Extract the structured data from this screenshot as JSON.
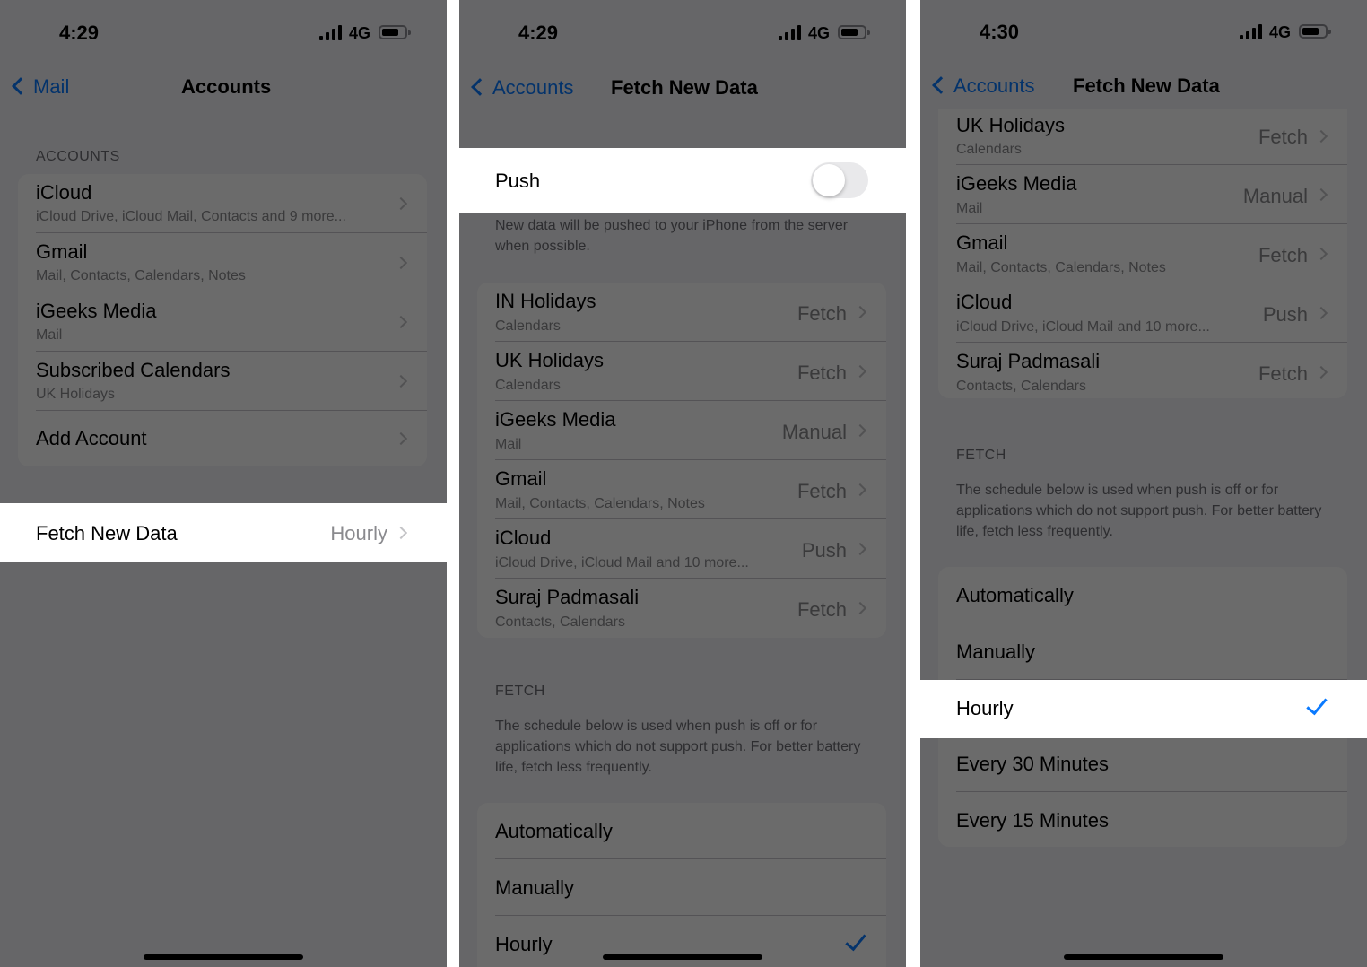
{
  "colors": {
    "accent": "#0a7aff",
    "background": "#f2f2f7",
    "secondary_text": "#8a8a8e"
  },
  "screen1": {
    "status": {
      "time": "4:29",
      "network": "4G"
    },
    "nav": {
      "back_label": "Mail",
      "title": "Accounts"
    },
    "section_label": "ACCOUNTS",
    "accounts": [
      {
        "title": "iCloud",
        "subtitle": "iCloud Drive, iCloud Mail, Contacts and 9 more..."
      },
      {
        "title": "Gmail",
        "subtitle": "Mail, Contacts, Calendars, Notes"
      },
      {
        "title": "iGeeks Media",
        "subtitle": "Mail"
      },
      {
        "title": "Subscribed Calendars",
        "subtitle": "UK Holidays"
      },
      {
        "title": "Add Account",
        "subtitle": ""
      }
    ],
    "fetch_row": {
      "label": "Fetch New Data",
      "value": "Hourly"
    }
  },
  "screen2": {
    "status": {
      "time": "4:29",
      "network": "4G"
    },
    "nav": {
      "back_label": "Accounts",
      "title": "Fetch New Data"
    },
    "push": {
      "label": "Push",
      "enabled": false,
      "footer": "New data will be pushed to your iPhone from the server when possible."
    },
    "accounts": [
      {
        "title": "IN Holidays",
        "subtitle": "Calendars",
        "value": "Fetch"
      },
      {
        "title": "UK Holidays",
        "subtitle": "Calendars",
        "value": "Fetch"
      },
      {
        "title": "iGeeks Media",
        "subtitle": "Mail",
        "value": "Manual"
      },
      {
        "title": "Gmail",
        "subtitle": "Mail, Contacts, Calendars, Notes",
        "value": "Fetch"
      },
      {
        "title": "iCloud",
        "subtitle": "iCloud Drive, iCloud Mail and 10 more...",
        "value": "Push"
      },
      {
        "title": "Suraj Padmasali",
        "subtitle": "Contacts, Calendars",
        "value": "Fetch"
      }
    ],
    "fetch_section": {
      "label": "FETCH",
      "footer": "The schedule below is used when push is off or for applications which do not support push. For better battery life, fetch less frequently."
    },
    "options": [
      {
        "label": "Automatically"
      },
      {
        "label": "Manually"
      },
      {
        "label": "Hourly",
        "selected": true
      }
    ]
  },
  "screen3": {
    "status": {
      "time": "4:30",
      "network": "4G"
    },
    "nav": {
      "back_label": "Accounts",
      "title": "Fetch New Data"
    },
    "accounts": [
      {
        "title": "UK Holidays",
        "subtitle": "Calendars",
        "value": "Fetch"
      },
      {
        "title": "iGeeks Media",
        "subtitle": "Mail",
        "value": "Manual"
      },
      {
        "title": "Gmail",
        "subtitle": "Mail, Contacts, Calendars, Notes",
        "value": "Fetch"
      },
      {
        "title": "iCloud",
        "subtitle": "iCloud Drive, iCloud Mail and 10 more...",
        "value": "Push"
      },
      {
        "title": "Suraj Padmasali",
        "subtitle": "Contacts, Calendars",
        "value": "Fetch"
      }
    ],
    "fetch_section": {
      "label": "FETCH",
      "footer": "The schedule below is used when push is off or for applications which do not support push. For better battery life, fetch less frequently."
    },
    "options": [
      {
        "label": "Automatically"
      },
      {
        "label": "Manually"
      },
      {
        "label": "Hourly",
        "selected": true
      },
      {
        "label": "Every 30 Minutes"
      },
      {
        "label": "Every 15 Minutes"
      }
    ]
  }
}
